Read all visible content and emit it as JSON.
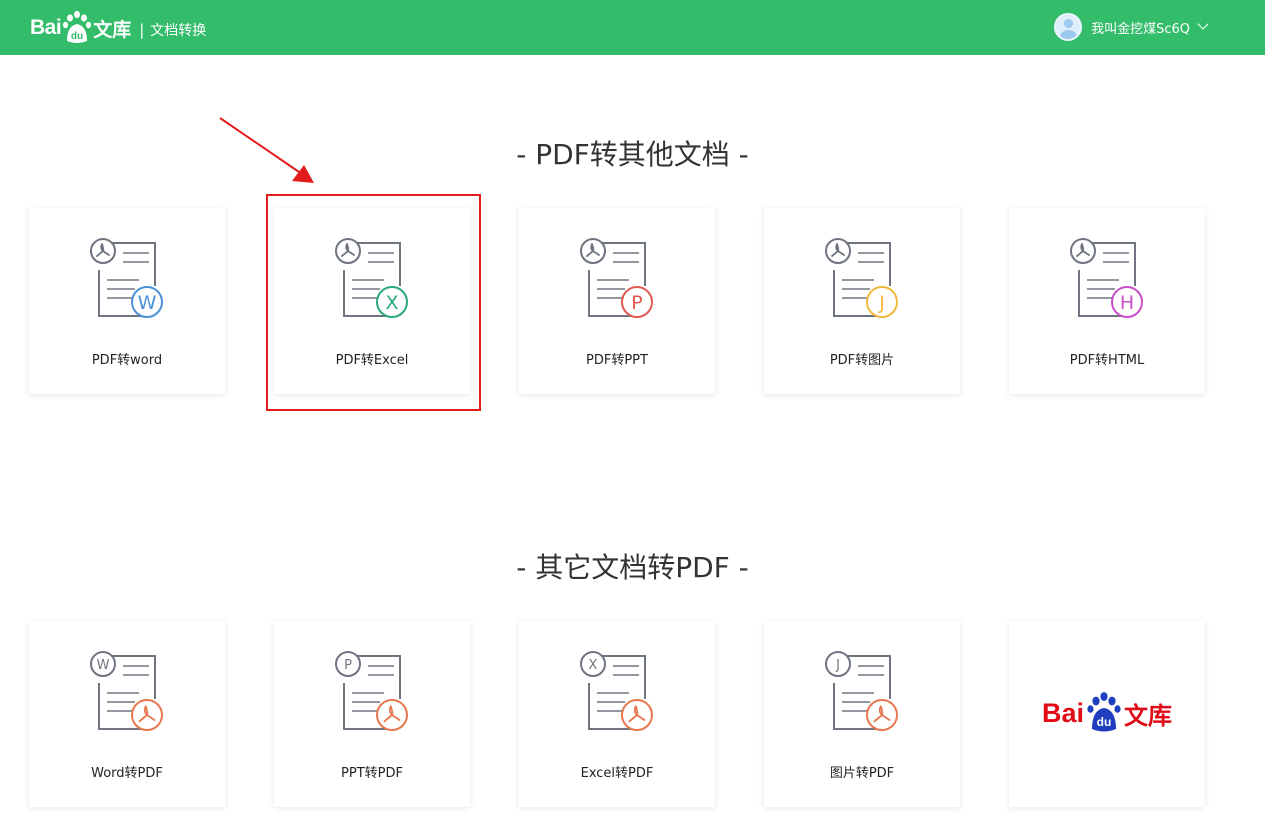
{
  "header": {
    "logo_text": "Bai",
    "logo_badge": "du",
    "logo_product": "文库",
    "separator": "|",
    "subtitle": "文档转换",
    "username": "我叫金挖煤Sc6Q",
    "header_color": "#33bd6a"
  },
  "sections": [
    {
      "title": "- PDF转其他文档 -",
      "cards": [
        {
          "label": "PDF转word",
          "badge": "W",
          "badge_color": "#4a90d9"
        },
        {
          "label": "PDF转Excel",
          "badge": "X",
          "badge_color": "#2aa876"
        },
        {
          "label": "PDF转PPT",
          "badge": "P",
          "badge_color": "#e05a4f"
        },
        {
          "label": "PDF转图片",
          "badge": "J",
          "badge_color": "#f0b93b"
        },
        {
          "label": "PDF转HTML",
          "badge": "H",
          "badge_color": "#c84fc8"
        }
      ]
    },
    {
      "title": "- 其它文档转PDF -",
      "cards": [
        {
          "label": "Word转PDF",
          "badge": "W",
          "badge_color": "#e8764f"
        },
        {
          "label": "PPT转PDF",
          "badge": "P",
          "badge_color": "#e8764f"
        },
        {
          "label": "Excel转PDF",
          "badge": "X",
          "badge_color": "#e8764f"
        },
        {
          "label": "图片转PDF",
          "badge": "J",
          "badge_color": "#e8764f"
        }
      ]
    }
  ],
  "brand_card": {
    "logo_text": "Bai",
    "logo_badge": "du",
    "logo_product": "文库",
    "color": "#e00b17"
  },
  "annotation": {
    "highlighted": "PDF转Excel",
    "color": "#e21b1b"
  }
}
